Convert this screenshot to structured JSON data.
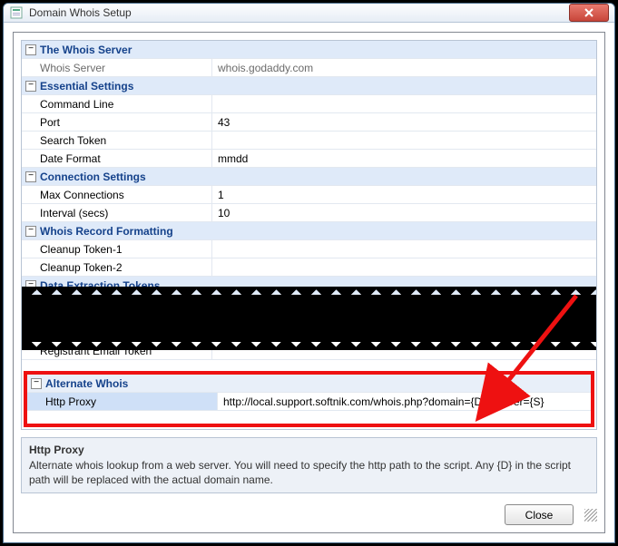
{
  "window": {
    "title": "Domain Whois Setup"
  },
  "groups": {
    "whois_server": {
      "title": "The Whois Server",
      "rows": {
        "whois_server": {
          "label": "Whois Server",
          "value": "whois.godaddy.com"
        }
      }
    },
    "essential": {
      "title": "Essential Settings",
      "rows": {
        "command_line": {
          "label": "Command Line",
          "value": ""
        },
        "port": {
          "label": "Port",
          "value": "43"
        },
        "search_token": {
          "label": "Search Token",
          "value": ""
        },
        "date_format": {
          "label": "Date Format",
          "value": "mmdd"
        }
      }
    },
    "connection": {
      "title": "Connection Settings",
      "rows": {
        "max_connections": {
          "label": "Max Connections",
          "value": "1"
        },
        "interval": {
          "label": "Interval (secs)",
          "value": "10"
        }
      }
    },
    "record_fmt": {
      "title": "Whois Record Formatting",
      "rows": {
        "cleanup1": {
          "label": "Cleanup Token-1",
          "value": ""
        },
        "cleanup2": {
          "label": "Cleanup Token-2",
          "value": ""
        }
      }
    },
    "extraction": {
      "title": "Data Extraction Tokens",
      "rows": {
        "reg_email": {
          "label": "Registrant Email Token",
          "value": ""
        }
      }
    },
    "alternate": {
      "title": "Alternate Whois",
      "rows": {
        "http_proxy": {
          "label": "Http Proxy",
          "value": "http://local.support.softnik.com/whois.php?domain={D}&server={S}"
        }
      }
    }
  },
  "help": {
    "title": "Http Proxy",
    "body": "Alternate whois lookup from a web server. You will need to specify the http path to the script. Any {D} in the script path will be replaced with the actual domain name."
  },
  "buttons": {
    "close": "Close"
  },
  "expander_glyph": "−"
}
